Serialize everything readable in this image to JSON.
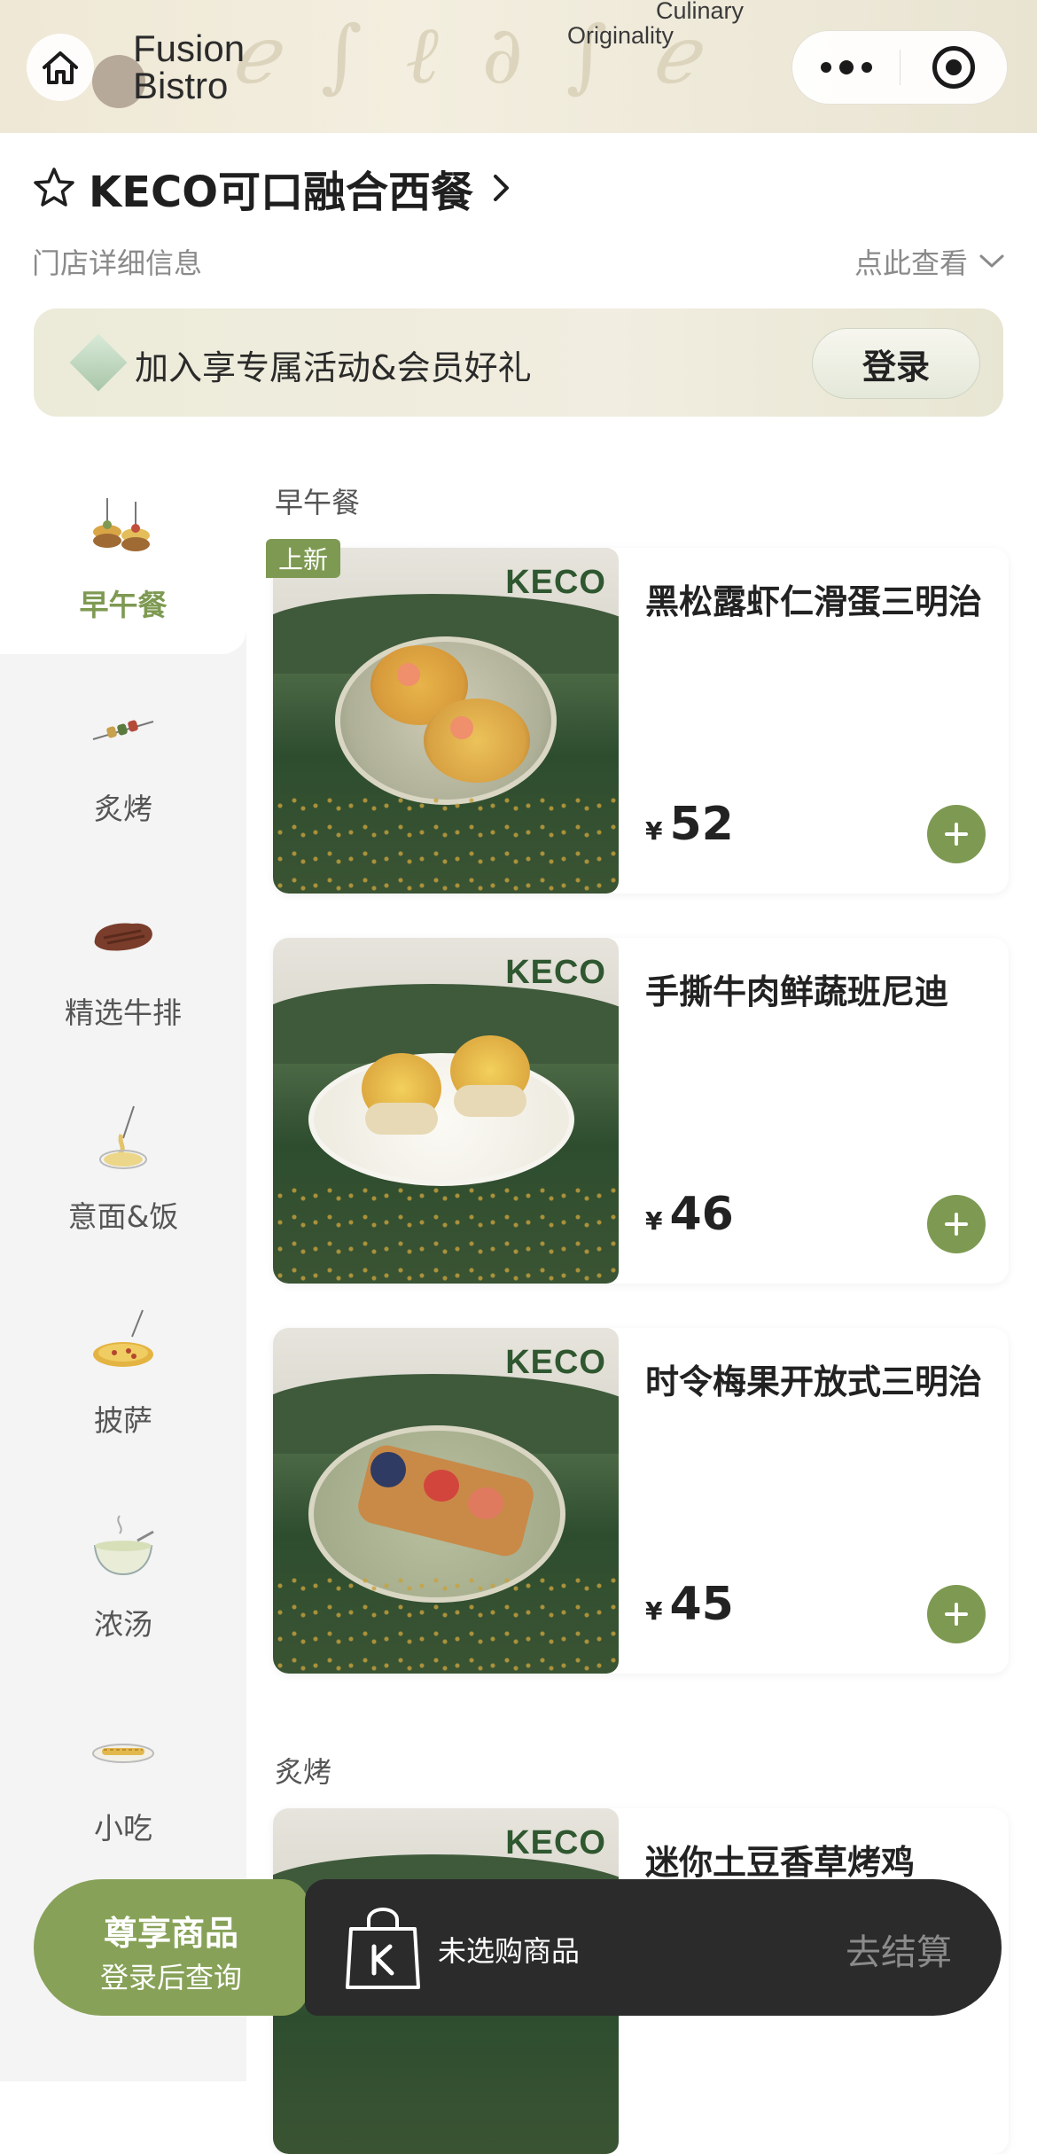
{
  "header": {
    "tagline_line1": "Culinary",
    "tagline_line2": "Originality",
    "logo_line1": "Fusion",
    "logo_line2": "Bistro"
  },
  "store": {
    "name": "KECO可口融合西餐",
    "subtitle": "门店详细信息",
    "view_more": "点此查看"
  },
  "member": {
    "text": "加入享专属活动&会员好礼",
    "login_label": "登录"
  },
  "categories": [
    {
      "label": "早午餐",
      "icon": "brunch-skewer-icon",
      "active": true
    },
    {
      "label": "炙烤",
      "icon": "skewer-icon",
      "active": false
    },
    {
      "label": "精选牛排",
      "icon": "steak-icon",
      "active": false
    },
    {
      "label": "意面&饭",
      "icon": "pasta-icon",
      "active": false
    },
    {
      "label": "披萨",
      "icon": "pizza-icon",
      "active": false
    },
    {
      "label": "浓汤",
      "icon": "soup-bowl-icon",
      "active": false
    },
    {
      "label": "小吃",
      "icon": "snack-icon",
      "active": false
    }
  ],
  "sections": [
    {
      "title": "早午餐",
      "items": [
        {
          "name": "黑松露虾仁滑蛋三明治",
          "currency": "¥",
          "price": "52",
          "badge": "上新",
          "brand": "KECO"
        },
        {
          "name": "手撕牛肉鲜蔬班尼迪",
          "currency": "¥",
          "price": "46",
          "badge": "",
          "brand": "KECO"
        },
        {
          "name": "时令梅果开放式三明治",
          "currency": "¥",
          "price": "45",
          "badge": "",
          "brand": "KECO"
        }
      ]
    },
    {
      "title": "炙烤",
      "items": [
        {
          "name": "迷你土豆香草烤鸡",
          "brand": "KECO"
        }
      ]
    }
  ],
  "bottom": {
    "premium_title": "尊享商品",
    "premium_sub": "登录后查询",
    "cart_empty": "未选购商品",
    "checkout": "去结算"
  },
  "colors": {
    "accent": "#7e9a52",
    "premium": "#87a258",
    "cart_bar": "#2b2b2b"
  }
}
